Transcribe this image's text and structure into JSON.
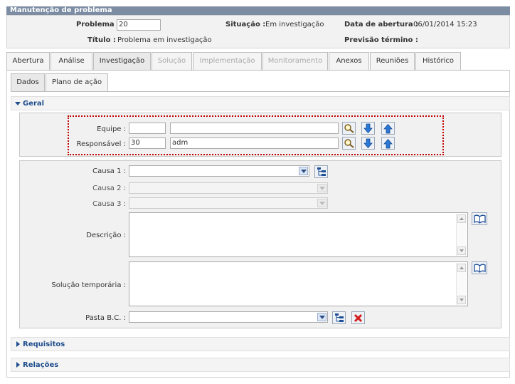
{
  "window_title": "Manutenção de problema",
  "header": {
    "problema_label": "Problema :",
    "problema_value": "20",
    "situacao_label": "Situação :",
    "situacao_value": "Em investigação",
    "data_abertura_label": "Data de abertura :",
    "data_abertura_value": "06/01/2014 15:23",
    "titulo_label": "Título :",
    "titulo_value": "Problema em investigação",
    "previsao_label": "Previsão término :",
    "previsao_value": ""
  },
  "main_tabs": [
    {
      "label": "Abertura",
      "state": "normal"
    },
    {
      "label": "Análise",
      "state": "normal"
    },
    {
      "label": "Investigação",
      "state": "active"
    },
    {
      "label": "Solução",
      "state": "disabled"
    },
    {
      "label": "Implementação",
      "state": "disabled"
    },
    {
      "label": "Monitoramento",
      "state": "disabled"
    },
    {
      "label": "Anexos",
      "state": "normal"
    },
    {
      "label": "Reuniões",
      "state": "normal"
    },
    {
      "label": "Histórico",
      "state": "normal"
    }
  ],
  "sub_tabs": [
    {
      "label": "Dados",
      "state": "active"
    },
    {
      "label": "Plano de ação",
      "state": "normal"
    }
  ],
  "sections": {
    "geral": "Geral",
    "requisitos": "Requisitos",
    "relacoes": "Relações"
  },
  "equipe": {
    "label": "Equipe :",
    "code": "",
    "name": ""
  },
  "responsavel": {
    "label": "Responsável :",
    "code": "30",
    "name": "adm"
  },
  "causa1": {
    "label": "Causa 1 :",
    "value": ""
  },
  "causa2": {
    "label": "Causa 2 :",
    "value": ""
  },
  "causa3": {
    "label": "Causa 3 :",
    "value": ""
  },
  "descricao": {
    "label": "Descrição :",
    "value": ""
  },
  "solucao_temporaria": {
    "label": "Solução temporária :",
    "value": ""
  },
  "pasta_bc": {
    "label": "Pasta B.C. :",
    "value": ""
  },
  "colors": {
    "title_bar": "#7b8ca3",
    "section_text": "#1f4d8c",
    "highlight_border": "#c00000"
  },
  "icons": [
    "search-icon",
    "arrow-down-icon",
    "arrow-up-icon",
    "tree-icon",
    "book-icon",
    "delete-icon",
    "triangle-down-icon",
    "triangle-right-icon"
  ]
}
